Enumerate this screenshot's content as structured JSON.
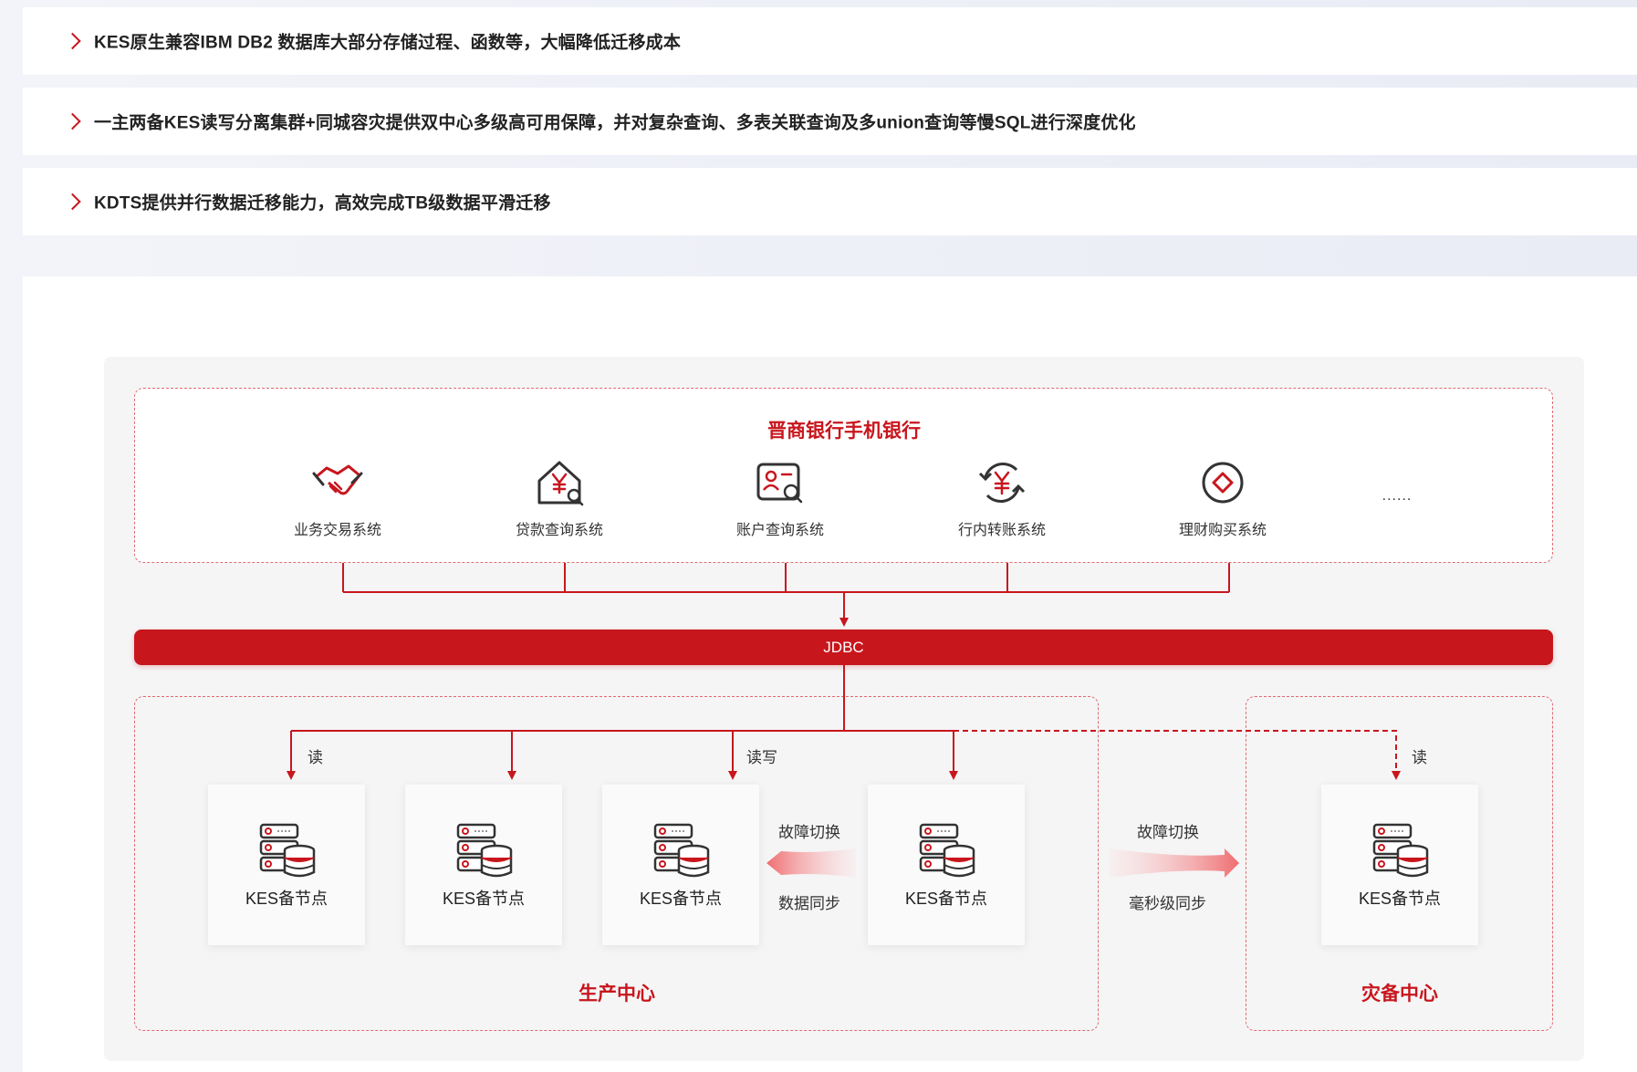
{
  "features": [
    "KES原生兼容IBM DB2 数据库大部分存储过程、函数等，大幅降低迁移成本",
    "一主两备KES读写分离集群+同城容灾提供双中心多级高可用保障，并对复杂查询、多表关联查询及多union查询等慢SQL进行深度优化",
    "KDTS提供并行数据迁移能力，高效完成TB级数据平滑迁移"
  ],
  "diagram": {
    "top_title": "晋商银行手机银行",
    "systems": [
      {
        "label": "业务交易系统",
        "icon": "handshake-icon"
      },
      {
        "label": "贷款查询系统",
        "icon": "house-yen-search-icon"
      },
      {
        "label": "账户查询系统",
        "icon": "account-search-icon"
      },
      {
        "label": "行内转账系统",
        "icon": "yen-refresh-icon"
      },
      {
        "label": "理财购买系统",
        "icon": "diamond-circle-icon"
      }
    ],
    "more": "......",
    "bus": "JDBC",
    "node_label": "KES备节点",
    "nodes": [
      "KES备节点",
      "KES备节点",
      "KES备节点",
      "KES备节点",
      "KES备节点"
    ],
    "read": "读",
    "readwrite": "读写",
    "read_dr": "读",
    "failover": "故障切换",
    "datasync": "数据同步",
    "failover_dr": "故障切换",
    "ms_sync": "毫秒级同步",
    "prod_center": "生产中心",
    "dr_center": "灾备中心",
    "accent": "#c8161d",
    "dash_color": "#e06b6f"
  }
}
